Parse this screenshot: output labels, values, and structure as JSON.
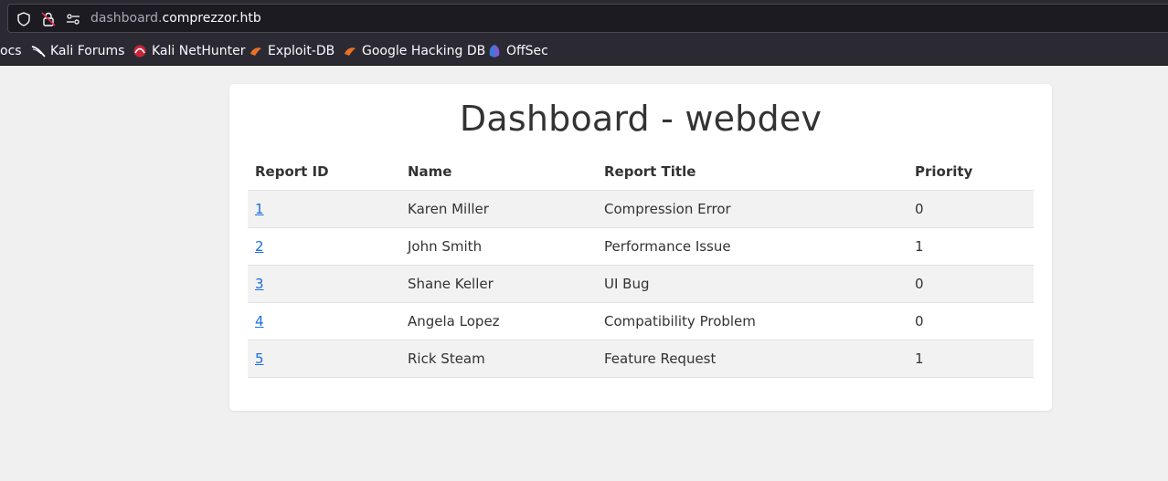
{
  "browser": {
    "url_host_prefix": "dashboard.",
    "url_host_domain": "comprezzor.htb",
    "icons": [
      "shield-icon",
      "lock-warning-icon",
      "permissions-icon"
    ]
  },
  "bookmarks": [
    {
      "label": "ocs",
      "icon": ""
    },
    {
      "label": "Kali Forums",
      "icon": "kali-dragon-icon"
    },
    {
      "label": "Kali NetHunter",
      "icon": "nethunter-icon"
    },
    {
      "label": "Exploit-DB",
      "icon": "exploitdb-icon"
    },
    {
      "label": "Google Hacking DB",
      "icon": "ghdb-icon"
    },
    {
      "label": "OffSec",
      "icon": "offsec-icon"
    }
  ],
  "page": {
    "title": "Dashboard - webdev",
    "columns": [
      "Report ID",
      "Name",
      "Report Title",
      "Priority"
    ],
    "rows": [
      {
        "id": "1",
        "name": "Karen Miller",
        "report_title": "Compression Error",
        "priority": "0"
      },
      {
        "id": "2",
        "name": "John Smith",
        "report_title": "Performance Issue",
        "priority": "1"
      },
      {
        "id": "3",
        "name": "Shane Keller",
        "report_title": "UI Bug",
        "priority": "0"
      },
      {
        "id": "4",
        "name": "Angela Lopez",
        "report_title": "Compatibility Problem",
        "priority": "0"
      },
      {
        "id": "5",
        "name": "Rick Steam",
        "report_title": "Feature Request",
        "priority": "1"
      }
    ]
  },
  "colors": {
    "link": "#1a6ee0",
    "chrome": "#2b2a33",
    "page_bg": "#f0f0f0"
  }
}
